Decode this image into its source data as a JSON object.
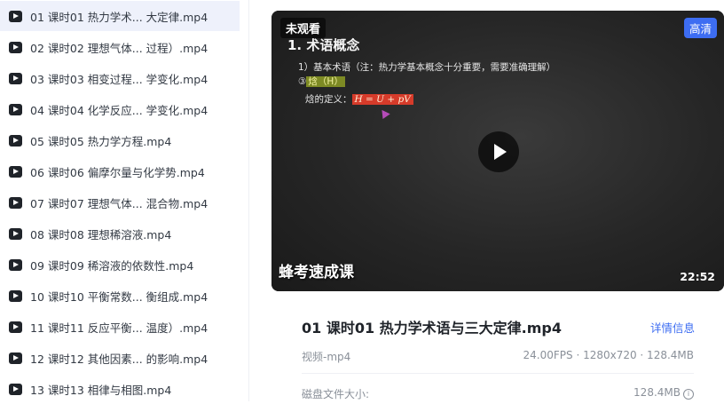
{
  "playlist": [
    {
      "label": "01 课时01 热力学术... 大定律.mp4",
      "active": true
    },
    {
      "label": "02 课时02 理想气体... 过程）.mp4"
    },
    {
      "label": "03 课时03 相变过程... 学变化.mp4"
    },
    {
      "label": "04 课时04 化学反应... 学变化.mp4"
    },
    {
      "label": "05 课时05 热力学方程.mp4"
    },
    {
      "label": "06 课时06 偏摩尔量与化学势.mp4"
    },
    {
      "label": "07 课时07 理想气体... 混合物.mp4"
    },
    {
      "label": "08 课时08 理想稀溶液.mp4"
    },
    {
      "label": "09 课时09 稀溶液的依数性.mp4"
    },
    {
      "label": "10 课时10 平衡常数... 衡组成.mp4"
    },
    {
      "label": "11 课时11 反应平衡... 温度）.mp4"
    },
    {
      "label": "12 课时12 其他因素... 的影响.mp4"
    },
    {
      "label": "13 课时13 相律与相图.mp4"
    }
  ],
  "player": {
    "unwatched_badge": "未观看",
    "quality_badge": "高清",
    "duration": "22:52",
    "watermark": "蜂考速成课",
    "slide": {
      "heading": "1. 术语概念",
      "line1": "1）基本术语（注：热力学基本概念十分重要，需要准确理解）",
      "line2_prefix": "③",
      "line2_highlight": "焓（H）",
      "line3_label": "焓的定义：",
      "line3_formula": "H = U + pV"
    }
  },
  "details": {
    "title": "01 课时01 热力学术语与三大定律.mp4",
    "detail_link": "详情信息",
    "file_type": "视频-mp4",
    "meta": "24.00FPS · 1280x720 · 128.4MB",
    "size_label": "磁盘文件大小:",
    "size_value": "128.4MB"
  },
  "colors": {
    "accent": "#3d6df2",
    "active_row": "#eef1fb"
  },
  "icons": {
    "playlist_item": "video-file-icon",
    "play": "play-icon",
    "info": "info-icon"
  }
}
